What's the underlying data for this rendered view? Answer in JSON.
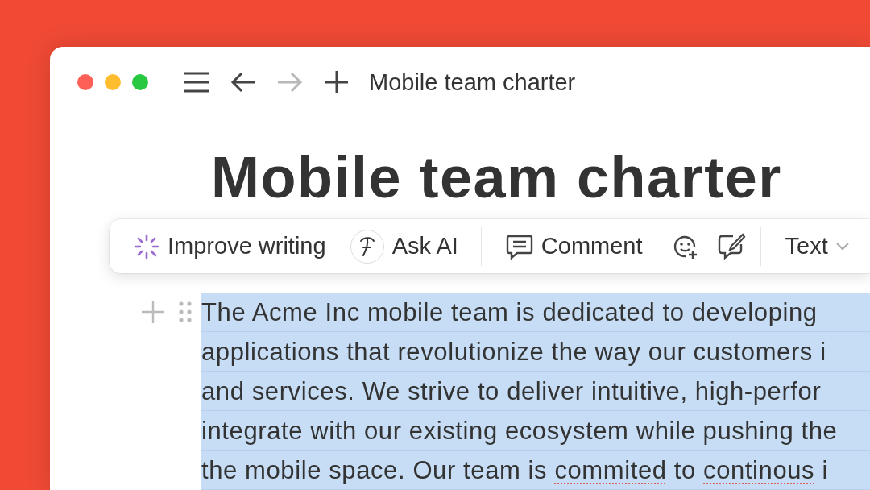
{
  "window": {
    "title": "Mobile team charter",
    "controls": [
      {
        "kind": "close"
      },
      {
        "kind": "minimize"
      },
      {
        "kind": "zoom"
      }
    ]
  },
  "nav": [
    {
      "kind": "menu",
      "disabled": false
    },
    {
      "kind": "back",
      "disabled": false
    },
    {
      "kind": "forward",
      "disabled": true
    },
    {
      "kind": "new",
      "disabled": false
    }
  ],
  "page": {
    "heading": "Mobile team charter"
  },
  "toolbar": [
    {
      "kind": "improve",
      "label": "Improve writing"
    },
    {
      "kind": "ask",
      "label": "Ask AI"
    },
    {
      "kind": "divider"
    },
    {
      "kind": "comment",
      "label": "Comment"
    },
    {
      "kind": "react"
    },
    {
      "kind": "suggest"
    },
    {
      "kind": "divider"
    },
    {
      "kind": "dropdown",
      "label": "Text"
    }
  ],
  "paragraph": {
    "selected": true,
    "lines": [
      [
        {
          "text": "The Acme Inc mobile team is dedicated to developing",
          "misspelled": false
        }
      ],
      [
        {
          "text": "applications that revolutionize the way our customers i",
          "misspelled": false
        }
      ],
      [
        {
          "text": "and services. We strive to deliver intuitive, high-perfor",
          "misspelled": false
        }
      ],
      [
        {
          "text": "integrate with our existing ecosystem while pushing the",
          "misspelled": false
        }
      ],
      [
        {
          "text": "the mobile space. Our team is ",
          "misspelled": false
        },
        {
          "text": "commited",
          "misspelled": true
        },
        {
          "text": " to ",
          "misspelled": false
        },
        {
          "text": "continous",
          "misspelled": true
        },
        {
          "text": " i",
          "misspelled": false
        }
      ]
    ]
  }
}
